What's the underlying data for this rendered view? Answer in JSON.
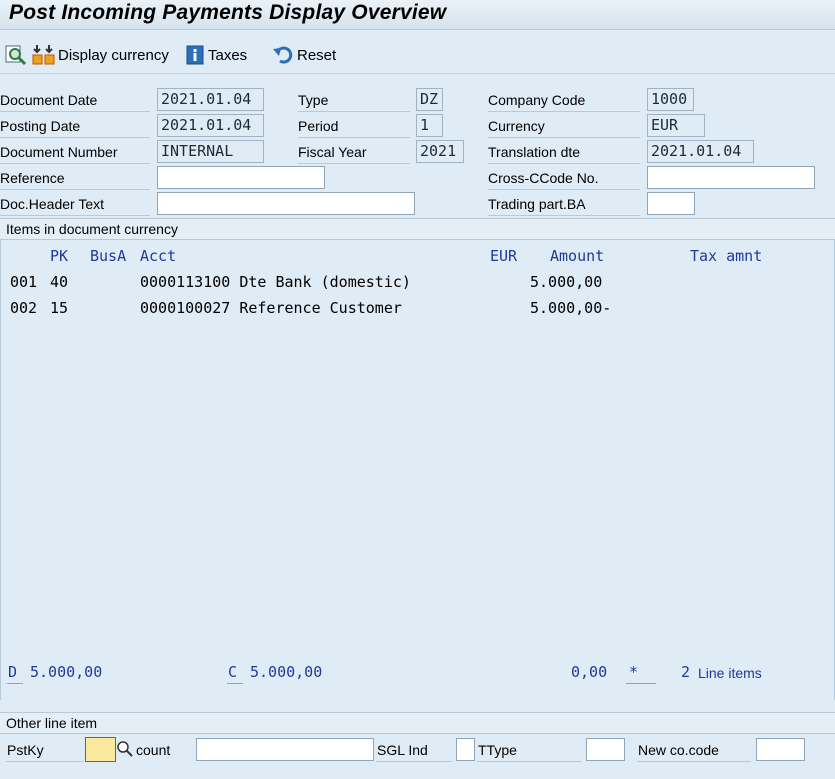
{
  "title": "Post Incoming Payments Display Overview",
  "toolbar": {
    "display_currency": "Display currency",
    "taxes": "Taxes",
    "reset": "Reset"
  },
  "header": {
    "document_date_label": "Document Date",
    "document_date": "2021.01.04",
    "posting_date_label": "Posting Date",
    "posting_date": "2021.01.04",
    "document_number_label": "Document Number",
    "document_number": "INTERNAL",
    "reference_label": "Reference",
    "reference": "",
    "doc_header_text_label": "Doc.Header Text",
    "doc_header_text": "",
    "type_label": "Type",
    "type": "DZ",
    "period_label": "Period",
    "period": "1",
    "fiscal_year_label": "Fiscal Year",
    "fiscal_year": "2021",
    "company_code_label": "Company Code",
    "company_code": "1000",
    "currency_label": "Currency",
    "currency": "EUR",
    "translation_dte_label": "Translation dte",
    "translation_dte": "2021.01.04",
    "cross_ccode_label": "Cross-CCode No.",
    "cross_ccode": "",
    "trading_part_label": "Trading part.BA",
    "trading_part": ""
  },
  "items_section": {
    "title": "Items in document currency",
    "columns": {
      "pk": "PK",
      "busa": "BusA",
      "acct": "Acct",
      "currency": "EUR",
      "amount": "Amount",
      "tax": "Tax amnt"
    },
    "rows": [
      {
        "item": "001",
        "pk": "40",
        "acct": "0000113100 Dte Bank (domestic)",
        "amount": "5.000,00"
      },
      {
        "item": "002",
        "pk": "15",
        "acct": "0000100027 Reference Customer",
        "amount": "5.000,00-"
      }
    ]
  },
  "totals": {
    "d_label": "D",
    "d_value": "5.000,00",
    "c_label": "C",
    "c_value": "5.000,00",
    "balance": "0,00",
    "star": "*",
    "line_count": "2",
    "line_items_label": "Line items"
  },
  "other_line": {
    "title": "Other line item",
    "pstky_label": "PstKy",
    "account_label": "count",
    "sgl_ind_label": "SGL Ind",
    "ttype_label": "TType",
    "new_cocode_label": "New co.code",
    "pstky": "",
    "account": "",
    "sgl_ind": "",
    "ttype": "",
    "new_cocode": ""
  }
}
